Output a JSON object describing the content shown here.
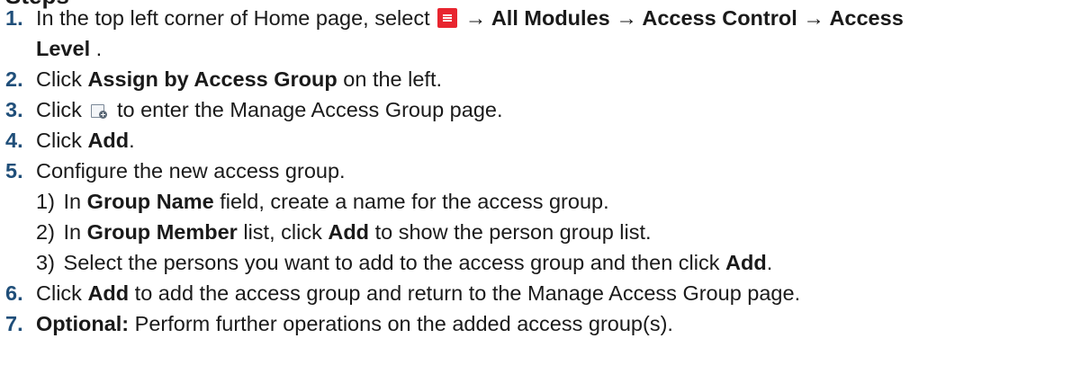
{
  "heading_fragment": "Steps",
  "steps": {
    "s1": {
      "num": "1.",
      "t1": "In the top left corner of Home page, select",
      "t2": "→ All Modules → Access Control → Access",
      "t3": "Level",
      "t4": "."
    },
    "s2": {
      "num": "2.",
      "t1": "Click",
      "b1": "Assign by Access Group",
      "t2": "on the left."
    },
    "s3": {
      "num": "3.",
      "t1": "Click",
      "t2": "to enter the Manage Access Group page."
    },
    "s4": {
      "num": "4.",
      "t1": "Click",
      "b1": "Add",
      "t2": "."
    },
    "s5": {
      "num": "5.",
      "t1": "Configure the new access group.",
      "sub1": {
        "num": "1)",
        "t1": "In",
        "b1": "Group Name",
        "t2": "field, create a name for the access group."
      },
      "sub2": {
        "num": "2)",
        "t1": "In",
        "b1": "Group Member",
        "t2": "list, click",
        "b2": "Add",
        "t3": "to show the person group list."
      },
      "sub3": {
        "num": "3)",
        "t1": "Select the persons you want to add to the access group and then click",
        "b1": "Add",
        "t2": "."
      }
    },
    "s6": {
      "num": "6.",
      "t1": "Click",
      "b1": "Add",
      "t2": "to add the access group and return to the Manage Access Group page."
    },
    "s7": {
      "num": "7.",
      "b1": "Optional:",
      "t1": "Perform further operations on the added access group(s)."
    }
  },
  "icons": {
    "menu": "menu-icon",
    "group": "add-access-group-icon"
  },
  "colors": {
    "menu_icon": "#e8252f",
    "step_number": "#1f4e79"
  }
}
